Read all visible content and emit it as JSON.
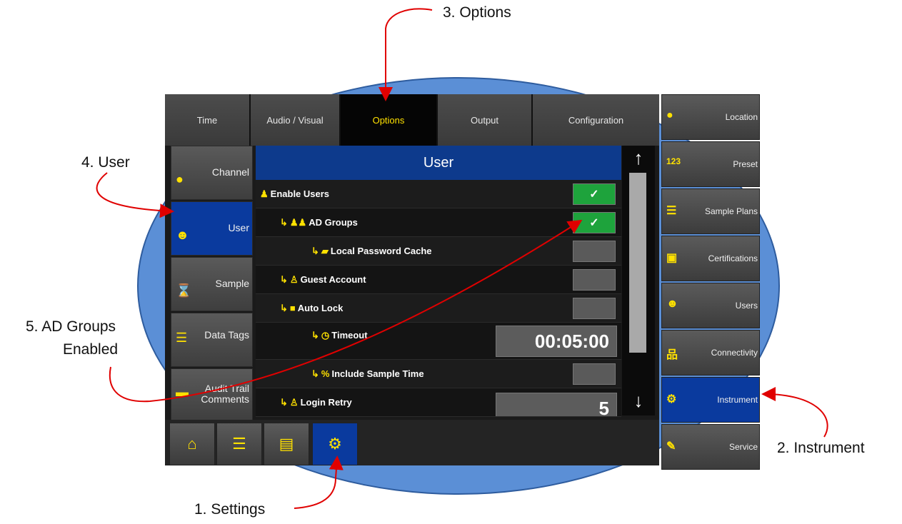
{
  "tabs": [
    "Time",
    "Audio / Visual",
    "Options",
    "Output",
    "Configuration"
  ],
  "active_tab": "Options",
  "left_nav": [
    {
      "label": "Channel",
      "icon": "channel-icon"
    },
    {
      "label": "User",
      "icon": "users-icon"
    },
    {
      "label": "Sample",
      "icon": "hourglass-icon"
    },
    {
      "label": "Data Tags",
      "icon": "list-icon"
    },
    {
      "label": "Audit Trail Comments",
      "icon": "comment-box-icon"
    }
  ],
  "panel": {
    "title": "User",
    "rows": [
      {
        "label": "Enable Users",
        "checked": true
      },
      {
        "label": "AD Groups",
        "checked": true
      },
      {
        "label": "Local Password Cache",
        "checked": false
      },
      {
        "label": "Guest Account",
        "checked": false
      },
      {
        "label": "Auto Lock",
        "checked": false
      },
      {
        "label": "Timeout",
        "value": "00:05:00"
      },
      {
        "label": "Include Sample Time",
        "checked": false
      },
      {
        "label": "Login Retry",
        "value": "5"
      }
    ],
    "check_mark": "✓"
  },
  "scroll": {
    "up": "↑",
    "down": "↓"
  },
  "right_nav": [
    {
      "label": "Location",
      "icon": "location-pin-icon"
    },
    {
      "label": "Preset",
      "icon": "123"
    },
    {
      "label": "Sample Plans",
      "icon": "sample-plans-icon"
    },
    {
      "label": "Certifications",
      "icon": "certificate-icon"
    },
    {
      "label": "Users",
      "icon": "users-icon"
    },
    {
      "label": "Connectivity",
      "icon": "network-icon"
    },
    {
      "label": "Instrument",
      "icon": "instrument-icon"
    },
    {
      "label": "Service",
      "icon": "wrench-icon"
    }
  ],
  "bottom_bar": [
    {
      "icon": "home-icon"
    },
    {
      "icon": "list-icon"
    },
    {
      "icon": "document-icon"
    },
    {
      "icon": "gear-icon"
    }
  ],
  "annotations": {
    "settings": "1. Settings",
    "instrument": "2. Instrument",
    "options": "3. Options",
    "user": "4. User",
    "ad_groups_line1": "5. AD Groups",
    "ad_groups_line2": "Enabled"
  },
  "colors": {
    "accent": "#ffe100",
    "selected": "#0a3a9e",
    "checked": "#1ea33c",
    "callout": "#e00000",
    "ellipse": "#5b8fd6"
  }
}
